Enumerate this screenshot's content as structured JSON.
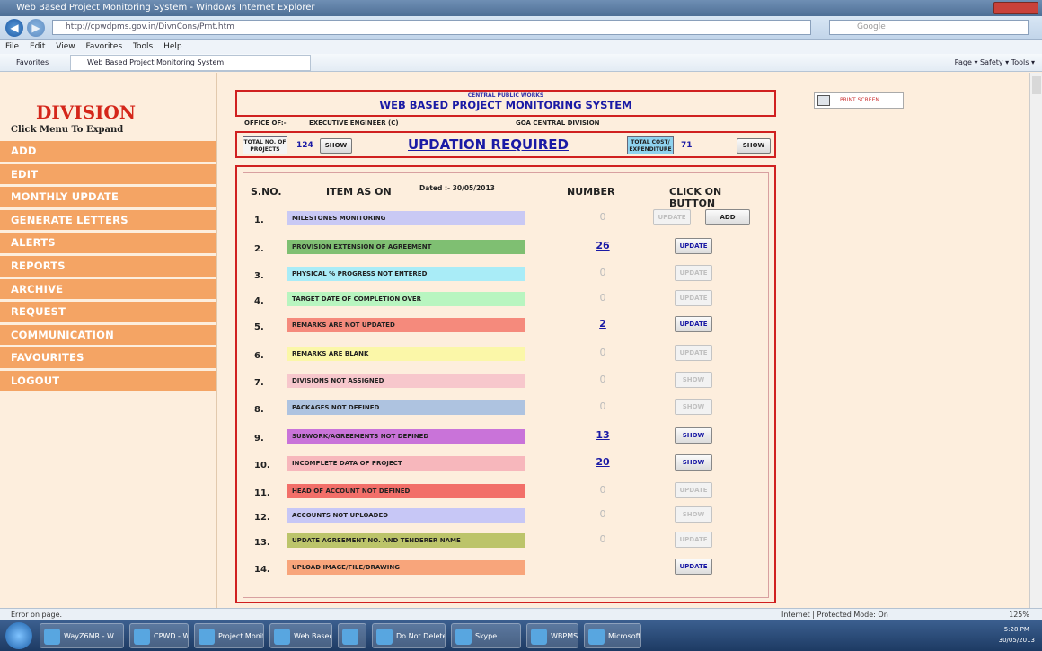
{
  "browser": {
    "title": "Web Based Project Monitoring System - Windows Internet Explorer",
    "url": "http://cpwdpms.gov.in/DivnCons/Prnt.htm",
    "search_placeholder": "Google",
    "menu": [
      "File",
      "Edit",
      "View",
      "Favorites",
      "Tools",
      "Help"
    ],
    "favorites_label": "Favorites",
    "tab_title": "Web Based Project Monitoring System",
    "tools_text": "Page ▾  Safety ▾  Tools ▾"
  },
  "sidebar": {
    "title": "DIVISION",
    "subtitle": "Click Menu To Expand",
    "items": [
      {
        "label": "ADD"
      },
      {
        "label": "EDIT"
      },
      {
        "label": "MONTHLY UPDATE"
      },
      {
        "label": "GENERATE LETTERS"
      },
      {
        "label": "ALERTS"
      },
      {
        "label": "REPORTS"
      },
      {
        "label": "ARCHIVE"
      },
      {
        "label": "REQUEST"
      },
      {
        "label": "COMMUNICATION"
      },
      {
        "label": "FAVOURITES"
      },
      {
        "label": "LOGOUT"
      }
    ]
  },
  "header": {
    "org": "CENTRAL PUBLIC WORKS",
    "system_title": "WEB BASED PROJECT MONITORING SYSTEM",
    "office_label": "OFFICE OF:-",
    "officer": "EXECUTIVE ENGINEER (C)",
    "division": "GOA CENTRAL DIVISION"
  },
  "print_label": "PRINT SCREEN",
  "summary": {
    "total_projects_label": "TOTAL NO. OF PROJECTS",
    "total_projects": "124",
    "show_label": "SHOW",
    "updation_title": "UPDATION REQUIRED",
    "total_cost_label": "TOTAL COST/ EXPENDITURE",
    "total_cost": "71",
    "show_label_2": "SHOW"
  },
  "table": {
    "col_sno": "S.NO.",
    "col_item": "ITEM AS ON",
    "dated": "Dated :- 30/05/2013",
    "col_number": "NUMBER",
    "col_action": "CLICK ON BUTTON",
    "rows": [
      {
        "sno": "1.",
        "item": "MILESTONES MONITORING",
        "color": "#c9c9f4",
        "number": "0",
        "active": false,
        "btn": "UPDATE",
        "btn2": "ADD"
      },
      {
        "sno": "2.",
        "item": "PROVISION EXTENSION OF AGREEMENT",
        "color": "#7fbf72",
        "number": "26",
        "active": true,
        "btn": "UPDATE"
      },
      {
        "sno": "3.",
        "item": "PHYSICAL % PROGRESS NOT ENTERED",
        "color": "#a9ecf7",
        "number": "0",
        "active": false,
        "btn": "UPDATE"
      },
      {
        "sno": "4.",
        "item": "TARGET DATE OF COMPLETION OVER",
        "color": "#b8f5c0",
        "number": "0",
        "active": false,
        "btn": "UPDATE"
      },
      {
        "sno": "5.",
        "item": "REMARKS ARE NOT UPDATED",
        "color": "#f58a7c",
        "number": "2",
        "active": true,
        "btn": "UPDATE"
      },
      {
        "sno": "6.",
        "item": "REMARKS ARE BLANK",
        "color": "#fbf7a8",
        "number": "0",
        "active": false,
        "btn": "UPDATE"
      },
      {
        "sno": "7.",
        "item": "DIVISIONS NOT ASSIGNED",
        "color": "#f7c7cc",
        "number": "0",
        "active": false,
        "btn": "SHOW"
      },
      {
        "sno": "8.",
        "item": "PACKAGES NOT DEFINED",
        "color": "#aec3e0",
        "number": "0",
        "active": false,
        "btn": "SHOW"
      },
      {
        "sno": "9.",
        "item": "SUBWORK/AGREEMENTS NOT DEFINED",
        "color": "#c973d9",
        "number": "13",
        "active": true,
        "btn": "SHOW"
      },
      {
        "sno": "10.",
        "item": "INCOMPLETE DATA OF PROJECT",
        "color": "#f7b7bc",
        "number": "20",
        "active": true,
        "btn": "SHOW"
      },
      {
        "sno": "11.",
        "item": "HEAD OF ACCOUNT NOT DEFINED",
        "color": "#f26f69",
        "number": "0",
        "active": false,
        "btn": "UPDATE"
      },
      {
        "sno": "12.",
        "item": "ACCOUNTS NOT UPLOADED",
        "color": "#c7c7f6",
        "number": "0",
        "active": false,
        "btn": "SHOW"
      },
      {
        "sno": "13.",
        "item": "UPDATE AGREEMENT NO. AND TENDERER NAME",
        "color": "#bcc46a",
        "number": "0",
        "active": false,
        "btn": "UPDATE"
      },
      {
        "sno": "14.",
        "item": "UPLOAD IMAGE/FILE/DRAWING",
        "color": "#f8a57b",
        "number": "",
        "active": true,
        "btn": "UPDATE"
      }
    ]
  },
  "status": {
    "left": "Error on page.",
    "mid": "Internet | Protected Mode: On",
    "zoom": "125%"
  },
  "taskbar": {
    "items": [
      "WayZ6MR - W...",
      "CPWD - Wind...",
      "Project Monit...",
      "Web Based Pr...",
      "",
      "Do Not Delete...",
      "Skype",
      "WBPMS_Steps...",
      "Microsoft Exc..."
    ],
    "time": "5:28 PM",
    "date": "30/05/2013"
  }
}
